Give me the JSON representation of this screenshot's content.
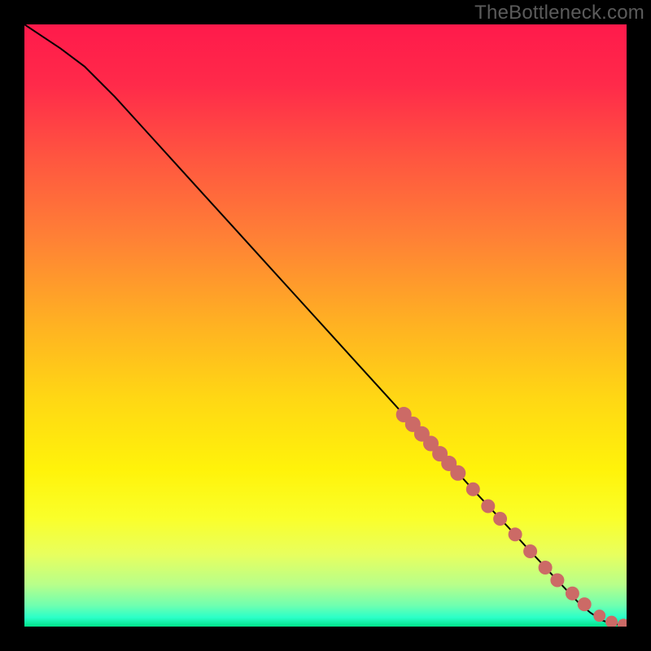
{
  "watermark": "TheBottleneck.com",
  "colors": {
    "gradient_stops": [
      {
        "offset": 0.0,
        "color": "#ff1a4b"
      },
      {
        "offset": 0.1,
        "color": "#ff2a4a"
      },
      {
        "offset": 0.22,
        "color": "#ff5540"
      },
      {
        "offset": 0.35,
        "color": "#ff7f36"
      },
      {
        "offset": 0.5,
        "color": "#ffb222"
      },
      {
        "offset": 0.62,
        "color": "#ffd714"
      },
      {
        "offset": 0.74,
        "color": "#fff30a"
      },
      {
        "offset": 0.82,
        "color": "#faff2a"
      },
      {
        "offset": 0.88,
        "color": "#e8ff5e"
      },
      {
        "offset": 0.93,
        "color": "#b8ff8a"
      },
      {
        "offset": 0.965,
        "color": "#6fffb0"
      },
      {
        "offset": 0.985,
        "color": "#2affc8"
      },
      {
        "offset": 1.0,
        "color": "#00e28a"
      }
    ],
    "curve": "#000000",
    "marker_fill": "#cc6a66",
    "marker_stroke": "#cc6a66",
    "frame": "#000000"
  },
  "chart_data": {
    "type": "line",
    "title": "",
    "xlabel": "",
    "ylabel": "",
    "xlim": [
      0,
      100
    ],
    "ylim": [
      0,
      100
    ],
    "grid": false,
    "legend": false,
    "series": [
      {
        "name": "bottleneck-curve",
        "x": [
          0,
          3,
          6,
          10,
          15,
          20,
          25,
          30,
          35,
          40,
          45,
          50,
          55,
          60,
          63,
          66,
          69,
          72,
          75,
          78,
          81,
          84,
          86,
          88,
          90,
          92,
          94,
          96,
          98,
          100
        ],
        "y": [
          100,
          98,
          96,
          93,
          88,
          82.5,
          77,
          71.5,
          66,
          60.5,
          55,
          49.5,
          44,
          38.5,
          35.2,
          32,
          28.7,
          25.5,
          22.2,
          19,
          15.8,
          12.5,
          10.4,
          8.2,
          6.1,
          4.0,
          2.3,
          1.0,
          0.4,
          0.2
        ]
      }
    ],
    "markers": {
      "name": "highlighted-points",
      "x": [
        63,
        64.5,
        66,
        67.5,
        69,
        70.5,
        72,
        74.5,
        77,
        79,
        81.5,
        84,
        86.5,
        88.5,
        91,
        93,
        95.5,
        97.5,
        99.5
      ],
      "y": [
        35.2,
        33.6,
        32.0,
        30.4,
        28.7,
        27.1,
        25.5,
        22.8,
        20.0,
        17.9,
        15.3,
        12.5,
        9.8,
        7.7,
        5.5,
        3.7,
        1.8,
        0.8,
        0.3
      ],
      "r": [
        9,
        9,
        9,
        9,
        9,
        9,
        9,
        8,
        8,
        8,
        8,
        8,
        8,
        8,
        8,
        8,
        7,
        7,
        7
      ]
    }
  }
}
